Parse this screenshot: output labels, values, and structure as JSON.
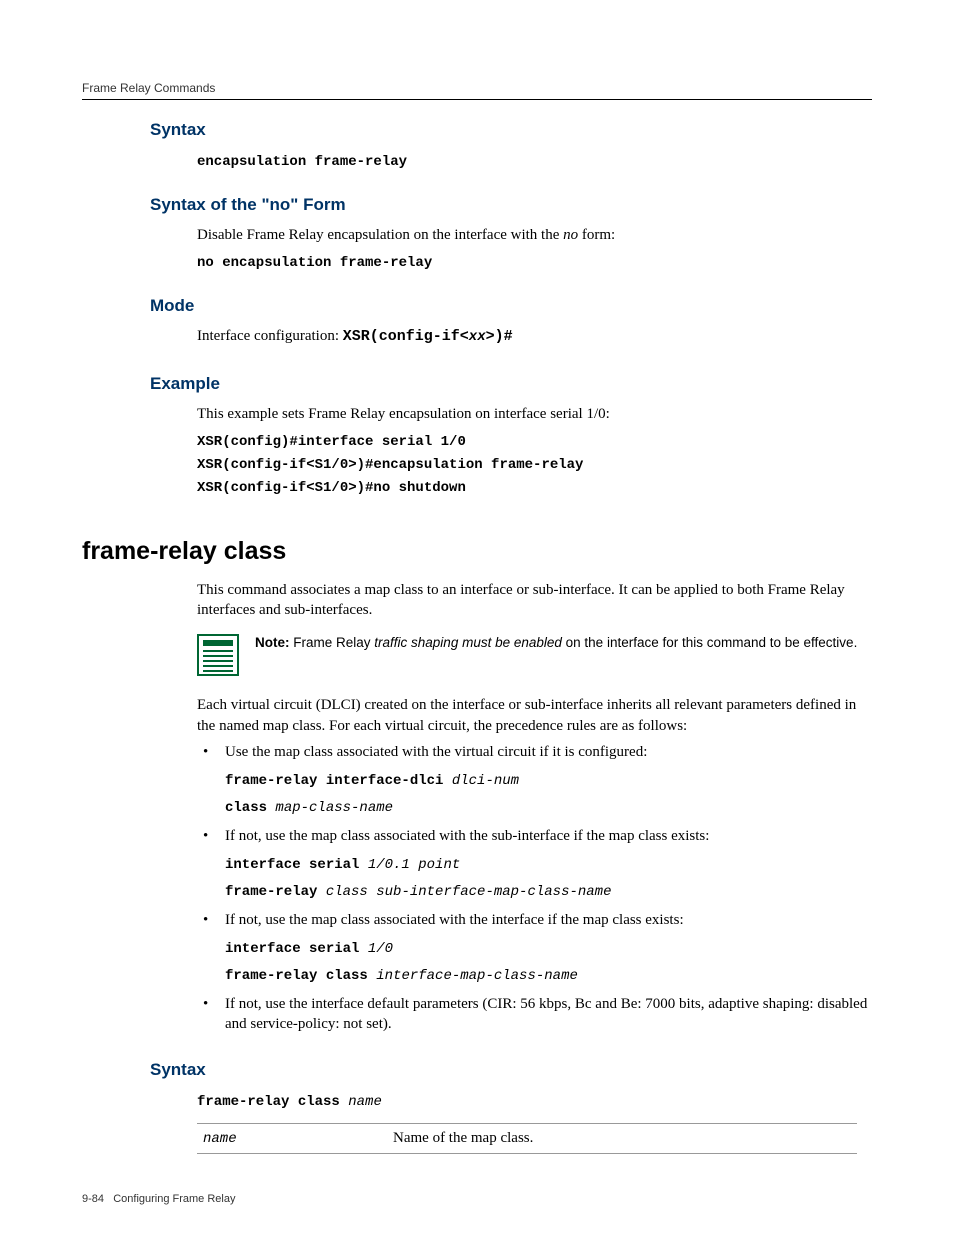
{
  "header": "Frame Relay Commands",
  "sec1": {
    "h": "Syntax",
    "code": "encapsulation frame-relay"
  },
  "sec2": {
    "h": "Syntax of the \"no\" Form",
    "p": "Disable Frame Relay encapsulation on the interface with the ",
    "p_it": "no",
    "p_tail": " form:",
    "code": "no encapsulation frame-relay"
  },
  "sec3": {
    "h": "Mode",
    "p": "Interface configuration: ",
    "code_a": "XSR(config-if<",
    "code_it": "xx",
    "code_b": ">)#"
  },
  "sec4": {
    "h": "Example",
    "p": "This example sets Frame Relay encapsulation on interface serial 1/0:",
    "code1": "XSR(config)#interface serial 1/0",
    "code2": "XSR(config-if<S1/0>)#encapsulation frame-relay",
    "code3": "XSR(config-if<S1/0>)#no shutdown"
  },
  "main": {
    "title": "frame-relay class",
    "p1": "This command associates a map class to an interface or sub-interface. It can be applied to both Frame Relay interfaces and sub-interfaces.",
    "note_label": "Note:",
    "note_a": " Frame Relay ",
    "note_it": "traffic shaping must be enabled",
    "note_b": " on the interface for this command to be effective.",
    "p2": "Each virtual circuit (DLCI) created on the interface or sub-interface inherits all relevant parameters defined in the named map class. For each virtual circuit, the precedence rules are as follows:",
    "b1": {
      "text": "Use the map class associated with the virtual circuit if it is configured:",
      "c1a": "frame-relay interface-dlci ",
      "c1b": "dlci-num",
      "c2a": "class ",
      "c2b": "map-class-name"
    },
    "b2": {
      "text": "If not, use the map class associated with the sub-interface if the map class exists:",
      "c1a": "interface serial ",
      "c1b": "1/0.1 point",
      "c2a": "frame-relay ",
      "c2b": "class sub-interface-map-class-name"
    },
    "b3": {
      "text": "If not, use the map class associated with the interface if the map class exists:",
      "c1a": "interface serial ",
      "c1b": "1/0",
      "c2a": "frame-relay class ",
      "c2b": "interface-map-class-name"
    },
    "b4": {
      "text": "If not, use the interface default parameters (CIR: 56 kbps, Bc and Be: 7000 bits, adaptive shaping: disabled and service-policy: not set)."
    }
  },
  "sec5": {
    "h": "Syntax",
    "code_a": "frame-relay class ",
    "code_it": "name",
    "param_name": "name",
    "param_desc": "Name of the map class."
  },
  "footer": {
    "page": "9-84",
    "title": "Configuring Frame Relay"
  }
}
